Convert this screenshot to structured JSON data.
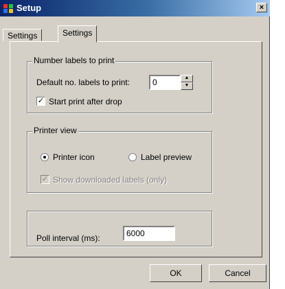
{
  "window": {
    "title": "Setup",
    "close_glyph": "×"
  },
  "tabs": [
    {
      "label": "Settings",
      "active": false
    },
    {
      "label": "Settings",
      "active": true
    }
  ],
  "labels_group": {
    "title": "Number labels to print",
    "default_label": "Default no. labels to print:",
    "default_value": "0",
    "start_print_label": "Start print after drop",
    "start_print_checked": true
  },
  "printer_group": {
    "title": "Printer view",
    "option_printer_icon": "Printer icon",
    "option_label_preview": "Label preview",
    "selected": "Printer icon",
    "show_downloaded_label": "Show downloaded labels (only)",
    "show_downloaded_checked": true
  },
  "poll": {
    "label": "Poll interval (ms):",
    "value": "6000"
  },
  "buttons": {
    "ok": "OK",
    "cancel": "Cancel"
  },
  "icons": {
    "check": "✓",
    "spin_up": "▲",
    "spin_down": "▼"
  }
}
